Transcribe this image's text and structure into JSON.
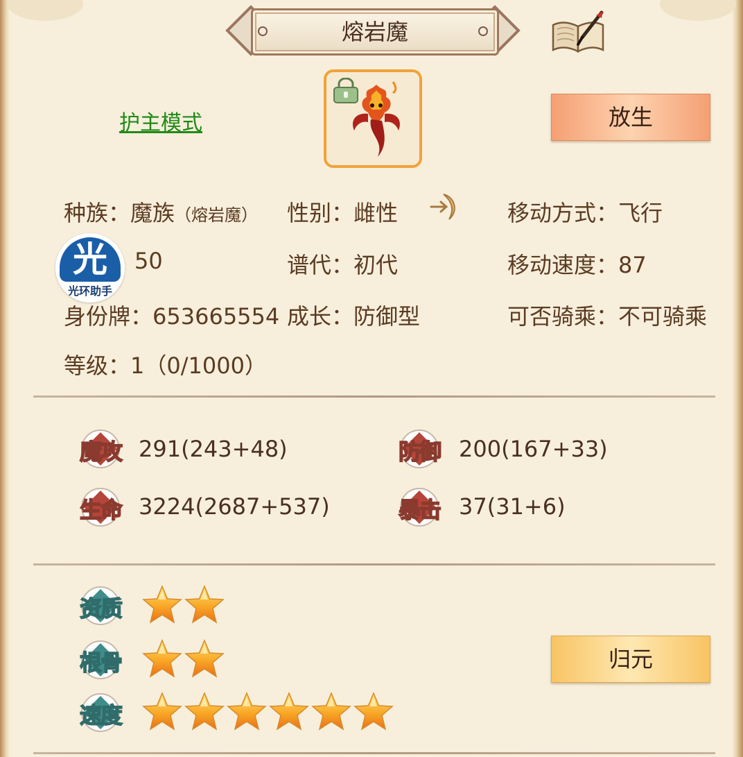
{
  "title": "熔岩魔",
  "guard_mode": "护主模式",
  "buttons": {
    "release": "放生",
    "return_origin": "归元"
  },
  "info": {
    "race_label": "种族：",
    "race_value": "魔族",
    "race_sub_open": "（",
    "race_sub": "熔岩魔",
    "race_sub_close": "）",
    "gender_label": "性别：",
    "gender_value": "雌性",
    "move_type_label": "移动方式：",
    "move_type_value": "飞行",
    "hidden_value": "50",
    "generation_label": "谱代：",
    "generation_value": "初代",
    "move_speed_label": "移动速度：",
    "move_speed_value": "87",
    "id_label": "身份牌：",
    "id_value": "653665554",
    "growth_label": "成长：",
    "growth_value": "防御型",
    "ride_label": "可否骑乘：",
    "ride_value": "不可骑乘",
    "level_label": "等级：",
    "level_value": "1（0/1000）"
  },
  "watermark": {
    "char": "光",
    "text": "光环助手"
  },
  "stats": {
    "mag_atk": {
      "label": "魔攻",
      "value": "291(243+48)"
    },
    "defense": {
      "label": "防御",
      "value": "200(167+33)"
    },
    "hp": {
      "label": "生命",
      "value": "3224(2687+537)"
    },
    "crit": {
      "label": "暴击",
      "value": "37(31+6)"
    }
  },
  "attributes": {
    "aptitude": {
      "label": "资质",
      "stars": 2
    },
    "bone": {
      "label": "根骨",
      "stars": 2
    },
    "speed": {
      "label": "速度",
      "stars": 6
    }
  },
  "icons": {
    "book": "book-quill-icon",
    "lock": "lock-icon",
    "gender": "female-crescent-icon",
    "star": "gold-star-icon"
  },
  "colors": {
    "background": "#f7efdc",
    "link_green": "#1f8a17",
    "release_button": "#f59f73",
    "return_button": "#f8c463",
    "badge_red": "#b5453a",
    "badge_teal": "#3f8c8a",
    "star_gold": "#f7a21b"
  }
}
